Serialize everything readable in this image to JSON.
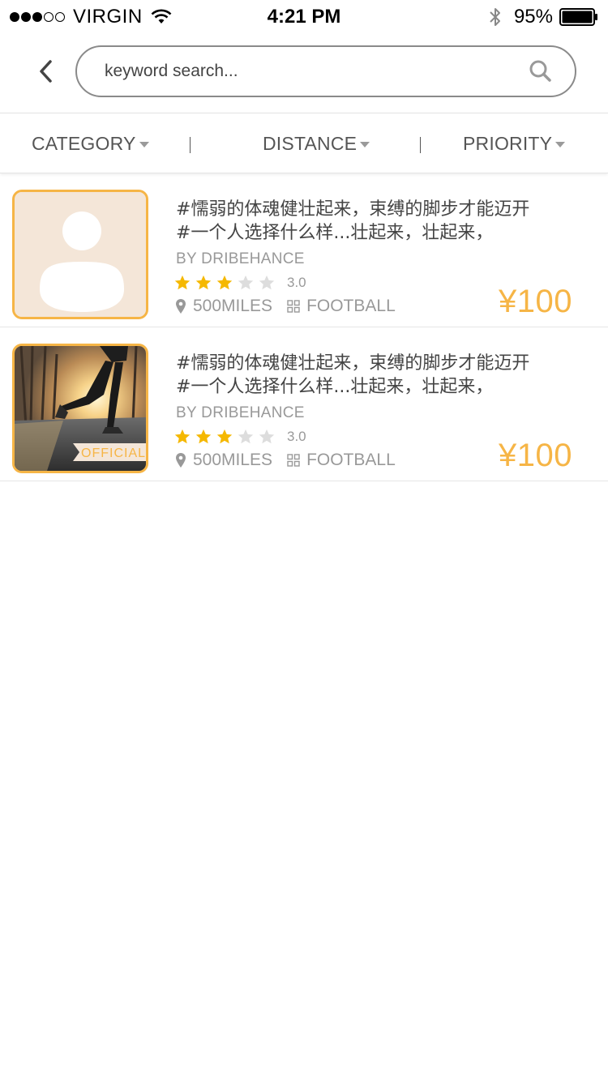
{
  "status_bar": {
    "carrier": "VIRGIN",
    "time": "4:21 PM",
    "battery": "95%",
    "signal_bars_filled": 3,
    "signal_bars_total": 5
  },
  "search": {
    "placeholder": "keyword search..."
  },
  "filters": {
    "category": "CATEGORY",
    "distance": "DISTANCE",
    "priority": "PRIORITY"
  },
  "colors": {
    "accent": "#f6b546",
    "star_on": "#f5b800",
    "star_off": "#dddddd",
    "muted_text": "#999999"
  },
  "items": [
    {
      "title_line1": "#懦弱的体魂健壮起来，束缚的脚步才能迈开",
      "title_line2": "#一个人选择什么样...壮起来，壮起来，",
      "author": "BY DRIBEHANCE",
      "stars": 3,
      "stars_total": 5,
      "rating": "3.0",
      "distance": "500MILES",
      "category": "FOOTBALL",
      "price": "¥100",
      "thumb": "avatar-placeholder"
    },
    {
      "title_line1": "#懦弱的体魂健壮起来，束缚的脚步才能迈开",
      "title_line2": "#一个人选择什么样...壮起来，壮起来，",
      "author": "BY DRIBEHANCE",
      "stars": 3,
      "stars_total": 5,
      "rating": "3.0",
      "distance": "500MILES",
      "category": "FOOTBALL",
      "price": "¥100",
      "thumb": "runner-photo",
      "badge": "OFFICIAL"
    }
  ]
}
